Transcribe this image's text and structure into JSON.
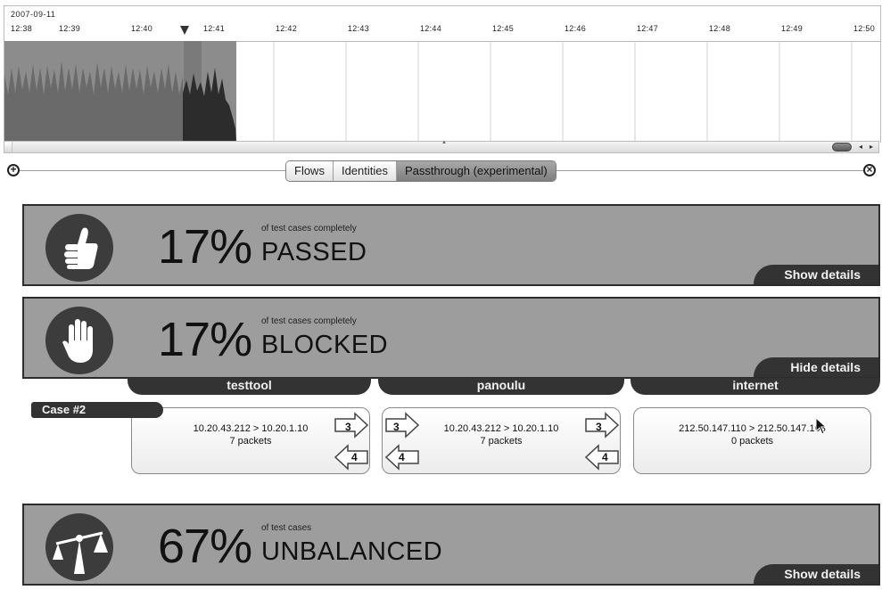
{
  "timeline": {
    "date": "2007-09-11",
    "ticks": [
      "12:38",
      "12:39",
      "12:40",
      "12:41",
      "12:42",
      "12:43",
      "12:44",
      "12:45",
      "12:46",
      "12:47",
      "12:48",
      "12:49",
      "12:50"
    ]
  },
  "scrollbar": {
    "left_arrow": "◂",
    "right_arrow": "▸"
  },
  "toolbar": {
    "add_symbol": "+",
    "close_symbol": "×",
    "tabs": [
      {
        "label": "Flows",
        "active": false
      },
      {
        "label": "Identities",
        "active": false
      },
      {
        "label": "Passthrough (experimental)",
        "active": true
      }
    ]
  },
  "panels": {
    "passed": {
      "percent": "17%",
      "caption": "of test cases completely",
      "status": "PASSED",
      "details_label": "Show details",
      "icon": "thumbs-up-icon"
    },
    "blocked": {
      "percent": "17%",
      "caption": "of test cases completely",
      "status": "BLOCKED",
      "details_label": "Hide details",
      "icon": "stop-hand-icon"
    },
    "unbalanced": {
      "percent": "67%",
      "caption": "of test cases",
      "status": "UNBALANCED",
      "details_label": "Show details",
      "icon": "scales-icon"
    }
  },
  "case_details": {
    "columns": [
      "testtool",
      "panoulu",
      "internet"
    ],
    "case_label": "Case #2",
    "boxes": [
      {
        "flow": "10.20.43.212 > 10.20.1.10",
        "packets": "7 packets",
        "right_out": "3",
        "right_in": "4"
      },
      {
        "flow": "10.20.43.212 > 10.20.1.10",
        "packets": "7 packets",
        "left_in": "3",
        "left_out": "4",
        "right_out": "3",
        "right_in": "4"
      },
      {
        "flow": "212.50.147.110 > 212.50.147.103",
        "packets": "0 packets"
      }
    ]
  },
  "colors": {
    "panel_fill": "#9d9d9d",
    "dark_accent": "#333333",
    "timeline_fill": "#6e6e6e"
  }
}
